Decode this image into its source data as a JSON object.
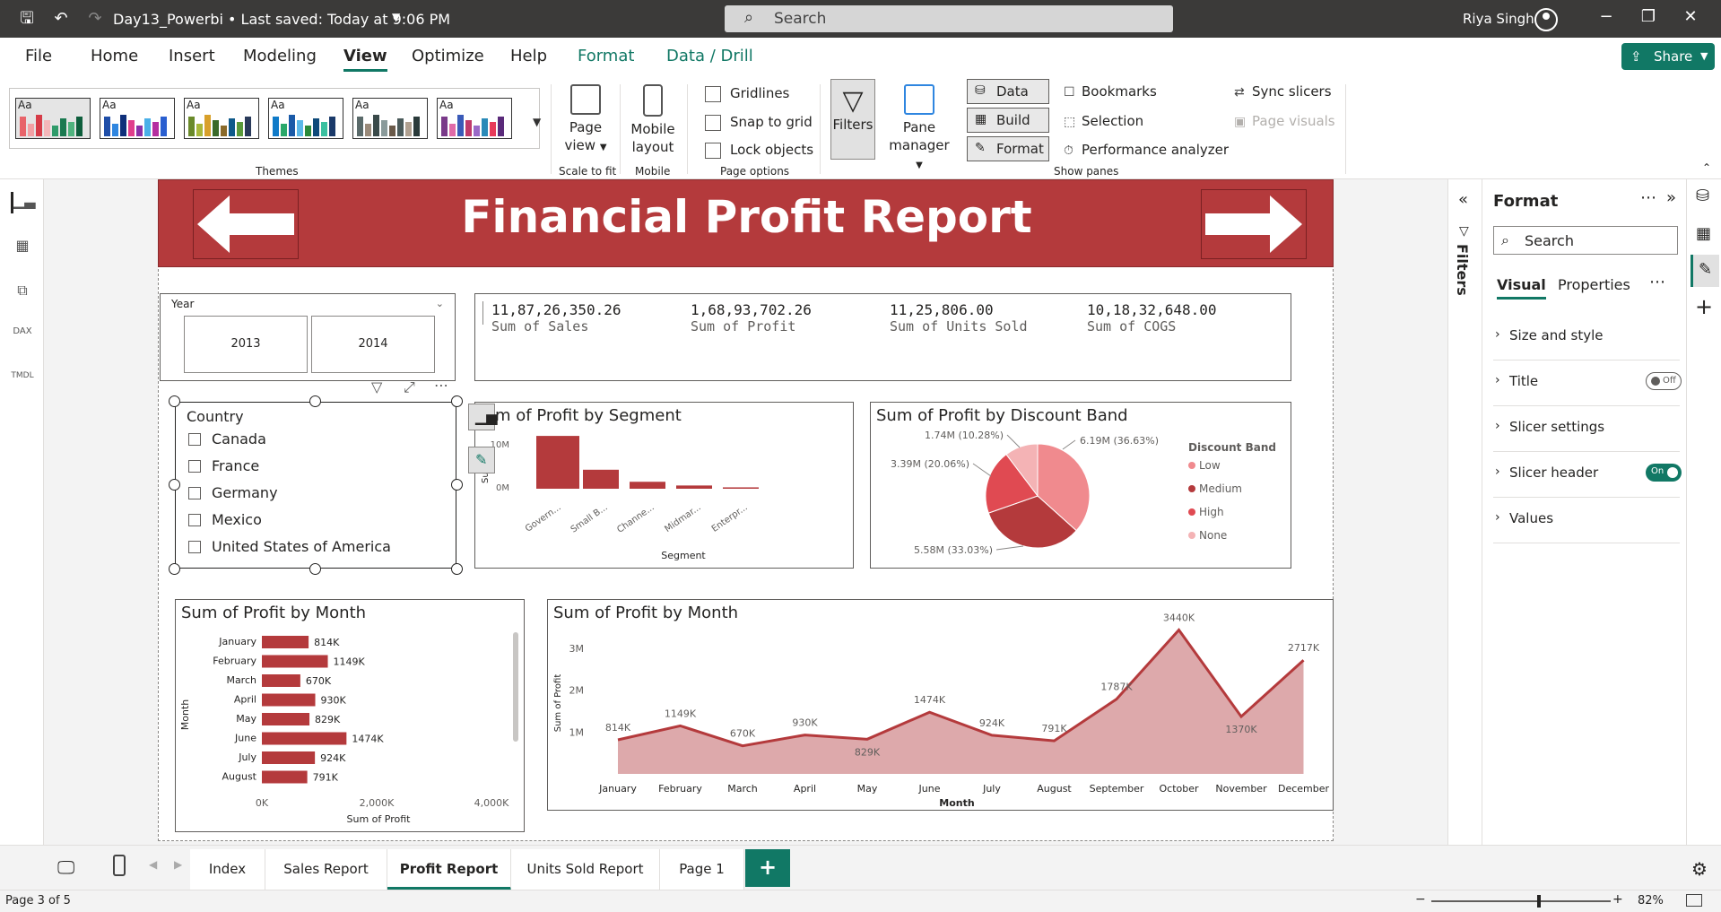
{
  "titlebar": {
    "filename": "Day13_Powerbi",
    "saved": "Last saved: Today at 9:06 PM",
    "search_placeholder": "Search",
    "user": "Riya Singh"
  },
  "menu": {
    "items": [
      "File",
      "Home",
      "Insert",
      "Modeling",
      "View",
      "Optimize",
      "Help",
      "Format",
      "Data / Drill"
    ],
    "active": "View",
    "share_label": "Share"
  },
  "ribbon": {
    "themes_label": "Themes",
    "theme_aa": "Aa",
    "page_view": "Page view",
    "scale_to_fit": "Scale to fit",
    "mobile_layout": "Mobile layout",
    "mobile_label": "Mobile",
    "gridlines": "Gridlines",
    "snap_to_grid": "Snap to grid",
    "lock_objects": "Lock objects",
    "page_options": "Page options",
    "filters": "Filters",
    "pane_manager": "Pane manager",
    "data": "Data",
    "build": "Build",
    "format": "Format",
    "bookmarks": "Bookmarks",
    "selection": "Selection",
    "performance_analyzer": "Performance analyzer",
    "sync_slicers": "Sync slicers",
    "page_visuals": "Page visuals",
    "show_panes": "Show panes"
  },
  "colors": {
    "accent": "#117865",
    "brand_red": "#b43a3c",
    "bar_red": "#b43a3c",
    "area_pink": "#d9a0a2"
  },
  "report": {
    "title": "Financial Profit Report",
    "year_slicer": {
      "header": "Year",
      "options": [
        "2013",
        "2014"
      ]
    },
    "kpis": [
      {
        "value": "11,87,26,350.26",
        "label": "Sum of Sales"
      },
      {
        "value": "1,68,93,702.26",
        "label": "Sum of Profit"
      },
      {
        "value": "11,25,806.00",
        "label": "Sum of Units Sold"
      },
      {
        "value": "10,18,32,648.00",
        "label": "Sum of COGS"
      }
    ],
    "country_slicer": {
      "header": "Country",
      "options": [
        "Canada",
        "France",
        "Germany",
        "Mexico",
        "United States of America"
      ]
    }
  },
  "chart_data": [
    {
      "type": "bar",
      "title": "m of Profit by Segment",
      "xlabel": "Segment",
      "ylabel": "Sum",
      "categories": [
        "Govern...",
        "Small B...",
        "Channe...",
        "Midmar...",
        "Enterpr..."
      ],
      "values": [
        11.4,
        4.1,
        1.5,
        0.7,
        0.3
      ],
      "value_unit": "M",
      "yticks": [
        "10M",
        "0M"
      ],
      "ylim": [
        0,
        12
      ]
    },
    {
      "type": "pie",
      "title": "Sum of Profit by Discount Band",
      "legend_title": "Discount Band",
      "legend_position": "right",
      "slices": [
        {
          "name": "Low",
          "value": 6.19,
          "label": "6.19M (36.63%)",
          "color": "#f08a8e"
        },
        {
          "name": "Medium",
          "value": 5.58,
          "label": "5.58M (33.03%)",
          "color": "#b43a3c"
        },
        {
          "name": "High",
          "value": 3.39,
          "label": "3.39M (20.06%)",
          "color": "#e04a52"
        },
        {
          "name": "None",
          "value": 1.74,
          "label": "1.74M (10.28%)",
          "color": "#f4b3b5"
        }
      ]
    },
    {
      "type": "bar",
      "orientation": "horizontal",
      "title": "Sum of Profit by Month",
      "xlabel": "Sum of Profit",
      "ylabel": "Month",
      "categories": [
        "January",
        "February",
        "March",
        "April",
        "May",
        "June",
        "July",
        "August"
      ],
      "values": [
        814,
        1149,
        670,
        930,
        829,
        1474,
        924,
        791
      ],
      "labels": [
        "814K",
        "1149K",
        "670K",
        "930K",
        "829K",
        "1474K",
        "924K",
        "791K"
      ],
      "xticks": [
        "0K",
        "2,000K",
        "4,000K"
      ],
      "xlim": [
        0,
        4000
      ]
    },
    {
      "type": "area",
      "title": "Sum of Profit by Month",
      "xlabel": "Month",
      "ylabel": "Sum of Profit",
      "categories": [
        "January",
        "February",
        "March",
        "April",
        "May",
        "June",
        "July",
        "August",
        "September",
        "October",
        "November",
        "December"
      ],
      "values": [
        814,
        1149,
        670,
        930,
        829,
        1474,
        924,
        791,
        1787,
        3440,
        1370,
        2717
      ],
      "labels": [
        "814K",
        "1149K",
        "670K",
        "930K",
        "829K",
        "1474K",
        "924K",
        "791K",
        "1787K",
        "3440K",
        "1370K",
        "2717K"
      ],
      "yticks": [
        "1M",
        "2M",
        "3M"
      ],
      "ylim": [
        0,
        3600
      ]
    }
  ],
  "format_pane": {
    "title": "Format",
    "search_placeholder": "Search",
    "tab_visual": "Visual",
    "tab_properties": "Properties",
    "sections": [
      {
        "label": "Size and style"
      },
      {
        "label": "Title",
        "toggle": "Off"
      },
      {
        "label": "Slicer settings"
      },
      {
        "label": "Slicer header",
        "toggle": "On"
      },
      {
        "label": "Values"
      }
    ]
  },
  "filters_strip": {
    "label": "Filters"
  },
  "tabs": [
    "Index",
    "Sales Report",
    "Profit Report",
    "Units Sold Report",
    "Page 1"
  ],
  "active_tab": "Profit Report",
  "status": {
    "page": "Page 3 of 5",
    "zoom": "82%"
  }
}
